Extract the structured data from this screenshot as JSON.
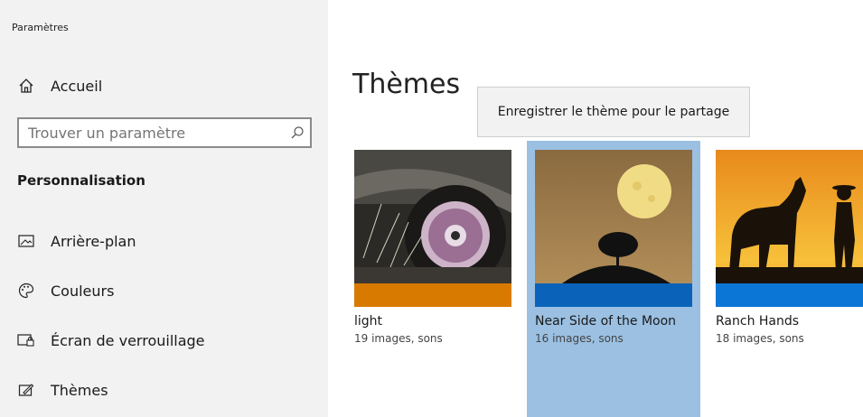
{
  "app_title": "Paramètres",
  "nav": {
    "home_label": "Accueil",
    "section_title": "Personnalisation",
    "items": [
      {
        "label": "Arrière-plan",
        "icon": "picture-icon"
      },
      {
        "label": "Couleurs",
        "icon": "palette-icon"
      },
      {
        "label": "Écran de verrouillage",
        "icon": "lock-screen-icon"
      },
      {
        "label": "Thèmes",
        "icon": "themes-icon"
      }
    ]
  },
  "search": {
    "placeholder": "Trouver un paramètre"
  },
  "main": {
    "title": "Thèmes",
    "tooltip": "Enregistrer le thème pour le partage",
    "themes": [
      {
        "name": "light",
        "meta": "19 images, sons",
        "accent": "#d97a00",
        "selected": false
      },
      {
        "name": "Near Side of the Moon",
        "meta": "16 images, sons",
        "accent": "#0a63b8",
        "selected": true
      },
      {
        "name": "Ranch Hands",
        "meta": "18 images, sons",
        "accent": "#0b76d6",
        "selected": false
      }
    ]
  },
  "colors": {
    "sidebar_bg": "#f2f2f2",
    "selected_bg": "#9bc0e2"
  }
}
